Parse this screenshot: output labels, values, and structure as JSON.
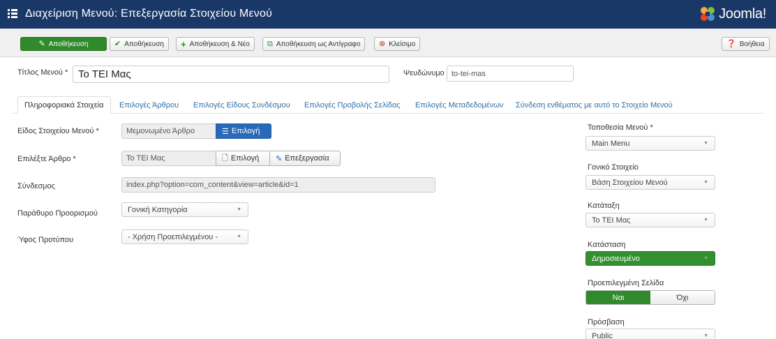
{
  "header": {
    "title": "Διαχείριση Μενού: Επεξεργασία Στοιχείου Μενού",
    "logo_text": "Joomla!",
    "menu_icon": "list-icon",
    "logo_icon": "joomla-logo-icon"
  },
  "toolbar": {
    "save": "Αποθήκευση",
    "save_close": "Αποθήκευση",
    "save_new": "Αποθήκευση & Νέο",
    "save_copy": "Αποθήκευση ως Αντίγραφο",
    "close": "Κλείσιμο",
    "help": "Βοήθεια"
  },
  "form": {
    "title_label": "Τίτλος Μενού *",
    "title_value": "Το ΤΕΙ Μας",
    "alias_label": "Ψευδώνυμο",
    "alias_value": "to-tei-mas"
  },
  "tabs": [
    {
      "label": "Πληροφοριακά Στοιχεία"
    },
    {
      "label": "Επιλογές Άρθρου"
    },
    {
      "label": "Επιλογές Είδους Συνδέσμου"
    },
    {
      "label": "Επιλογές Προβολής Σελίδας"
    },
    {
      "label": "Επιλογές Μεταδεδομένων"
    },
    {
      "label": "Σύνδεση ενθέματος με αυτό το Στοιχείο Μενού"
    }
  ],
  "details": {
    "type_label": "Είδος Στοιχείου Μενού *",
    "type_value": "Μεμονωμένο Άρθρο",
    "type_select": "Επιλογή",
    "article_label": "Επιλέξτε Άρθρο *",
    "article_value": "Το ΤΕΙ Μας",
    "article_select": "Επιλογή",
    "article_edit": "Επεξεργασία",
    "link_label": "Σύνδεσμος",
    "link_value": "index.php?option=com_content&view=article&id=1",
    "target_label": "Παράθυρο Προορισμού",
    "target_value": "Γονική Κατηγορία",
    "style_label": "Ύφος Προτύπου",
    "style_value": "- Χρήση Προεπιλεγμένου -"
  },
  "sidebar": {
    "menu_label": "Τοποθεσία Μενού *",
    "menu_value": "Main Menu",
    "parent_label": "Γονικό Στοιχείο",
    "parent_value": "Βάση Στοιχείου Μενού",
    "order_label": "Κατάταξη",
    "order_value": "Το ΤΕΙ Μας",
    "status_label": "Κατάσταση",
    "status_value": "Δημοσιευμένο",
    "home_label": "Προεπιλεγμένη Σελίδα",
    "home_yes": "Ναι",
    "home_no": "Όχι",
    "access_label": "Πρόσβαση",
    "access_value": "Public"
  },
  "colors": {
    "header_bg": "#1a3867",
    "primary_green": "#2f8a2b",
    "select_blue": "#2a69b8",
    "link_blue": "#2f6fa8"
  }
}
